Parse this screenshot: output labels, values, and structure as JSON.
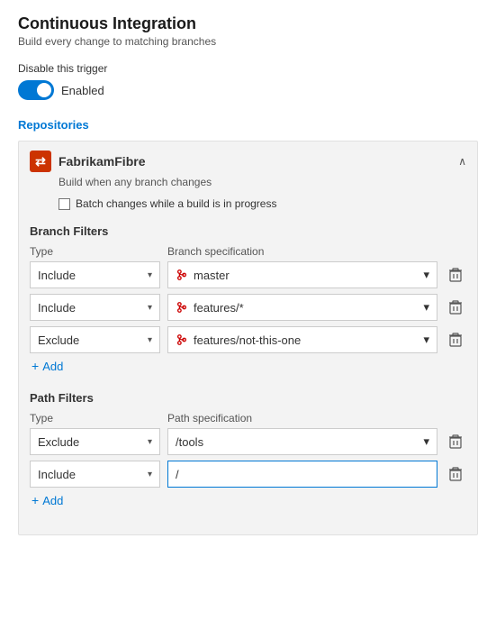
{
  "page": {
    "title": "Continuous Integration",
    "subtitle": "Build every change to matching branches"
  },
  "trigger": {
    "disable_label": "Disable this trigger",
    "toggle_label": "Enabled",
    "toggle_on": true
  },
  "repositories": {
    "section_label": "Repositories",
    "repo": {
      "name": "FabrikamFibre",
      "subtitle": "Build when any branch changes",
      "batch_label": "Batch changes while a build is in progress"
    }
  },
  "branch_filters": {
    "title": "Branch Filters",
    "type_col": "Type",
    "spec_col": "Branch specification",
    "rows": [
      {
        "type": "Include",
        "spec": "master"
      },
      {
        "type": "Include",
        "spec": "features/*"
      },
      {
        "type": "Exclude",
        "spec": "features/not-this-one"
      }
    ],
    "add_label": "Add"
  },
  "path_filters": {
    "title": "Path Filters",
    "type_col": "Type",
    "spec_col": "Path specification",
    "rows": [
      {
        "type": "Exclude",
        "spec": "/tools"
      },
      {
        "type": "Include",
        "spec": "/"
      }
    ],
    "add_label": "Add"
  },
  "icons": {
    "chevron_down": "▾",
    "chevron_up": "∧",
    "plus": "+",
    "delete": "🗑",
    "trash": "⊡"
  }
}
